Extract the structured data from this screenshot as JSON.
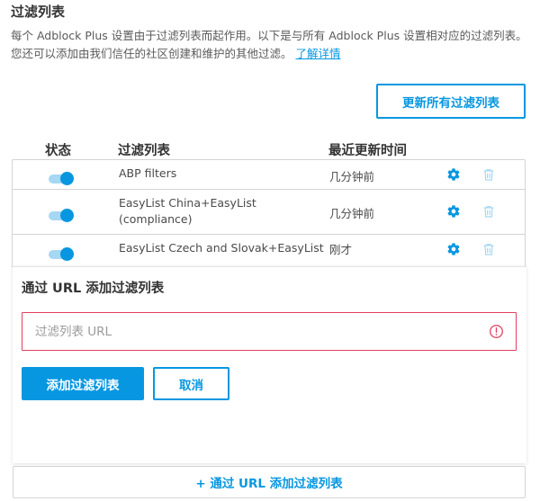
{
  "section": {
    "title": "过滤列表",
    "description": "每个 Adblock Plus 设置由于过滤列表而起作用。以下是与所有 Adblock Plus 设置相对应的过滤列表。您还可以添加由我们信任的社区创建和维护的其他过滤。",
    "learn_more": "了解详情"
  },
  "update_all_button": "更新所有过滤列表",
  "table": {
    "headers": {
      "status": "状态",
      "filter_list": "过滤列表",
      "last_updated": "最近更新时间"
    },
    "rows": [
      {
        "name": "ABP filters",
        "updated": "几分钟前",
        "enabled": true
      },
      {
        "name": "EasyList China+EasyList (compliance)",
        "updated": "几分钟前",
        "enabled": true
      },
      {
        "name": "EasyList Czech and Slovak+EasyList",
        "updated": "刚才",
        "enabled": true
      }
    ]
  },
  "dialog": {
    "title": "通过 URL 添加过滤列表",
    "input_placeholder": "过滤列表 URL",
    "input_value": "",
    "add_button": "添加过滤列表",
    "cancel_button": "取消"
  },
  "add_by_url_link": "+ 通过 URL 添加过滤列表",
  "colors": {
    "accent": "#0797e1",
    "toggle_track": "#a6d7f3",
    "error": "#e1405f"
  },
  "icons": {
    "settings": "gear-icon",
    "delete": "trash-icon",
    "error": "alert-circle-icon"
  }
}
